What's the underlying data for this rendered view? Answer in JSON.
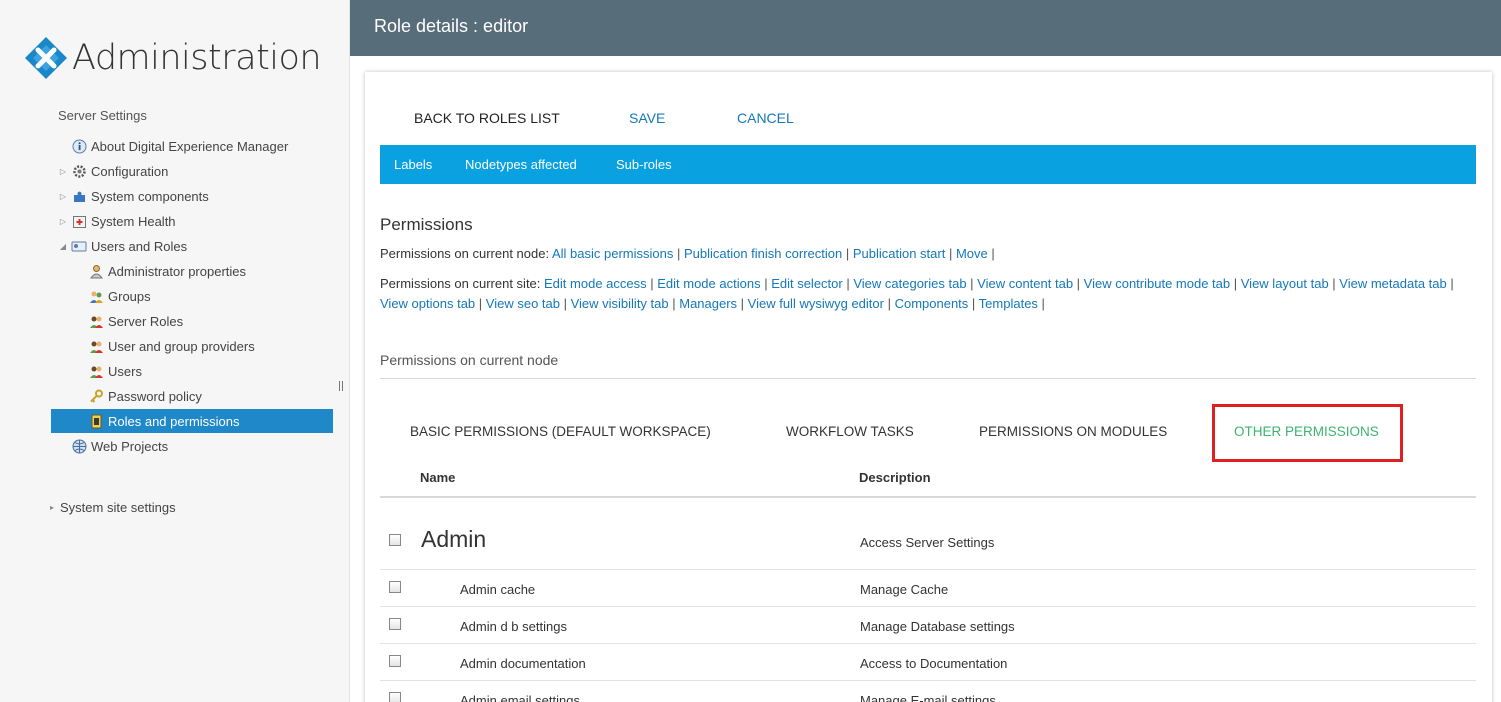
{
  "sidebar": {
    "app_title": "Administration",
    "server_settings_label": "Server Settings",
    "items": [
      {
        "label": "About Digital Experience Manager"
      },
      {
        "label": "Configuration"
      },
      {
        "label": "System components"
      },
      {
        "label": "System Health"
      },
      {
        "label": "Users and Roles"
      },
      {
        "label": "Administrator properties"
      },
      {
        "label": "Groups"
      },
      {
        "label": "Server Roles"
      },
      {
        "label": "User and group providers"
      },
      {
        "label": "Users"
      },
      {
        "label": "Password policy"
      },
      {
        "label": "Roles and permissions"
      },
      {
        "label": "Web Projects"
      }
    ],
    "system_site_settings_label": "System site settings"
  },
  "header": {
    "title": "Role details : editor"
  },
  "actions": {
    "back": "BACK TO ROLES LIST",
    "save": "SAVE",
    "cancel": "CANCEL"
  },
  "tabs": {
    "labels": "Labels",
    "nodetypes": "Nodetypes affected",
    "subroles": "Sub-roles"
  },
  "permissions": {
    "title": "Permissions",
    "node_prefix": "Permissions on current node: ",
    "node_links": [
      "All basic permissions",
      "Publication finish correction",
      "Publication start",
      "Move"
    ],
    "site_prefix": "Permissions on current site: ",
    "site_links": [
      "Edit mode access",
      "Edit mode actions",
      "Edit selector",
      "View categories tab",
      "View content tab",
      "View contribute mode tab",
      "View layout tab",
      "View metadata tab",
      "View options tab",
      "View seo tab",
      "View visibility tab",
      "Managers",
      "View full wysiwyg editor",
      "Components",
      "Templates"
    ]
  },
  "node_section": {
    "title": "Permissions on current node"
  },
  "perm_tabs": {
    "basic": "BASIC PERMISSIONS (DEFAULT WORKSPACE)",
    "workflow": "WORKFLOW TASKS",
    "modules": "PERMISSIONS ON MODULES",
    "other": "OTHER PERMISSIONS"
  },
  "table": {
    "col_name": "Name",
    "col_description": "Description",
    "group": {
      "name": "Admin",
      "description": "Access Server Settings"
    },
    "rows": [
      {
        "name": "Admin cache",
        "description": "Manage Cache"
      },
      {
        "name": "Admin d b settings",
        "description": "Manage Database settings"
      },
      {
        "name": "Admin documentation",
        "description": "Access to Documentation"
      },
      {
        "name": "Admin email settings",
        "description": "Manage E-mail settings"
      }
    ]
  },
  "colors": {
    "accent_blue": "#0aa1e0",
    "header_bg": "#586d7a",
    "selected_bg": "#1e88c9",
    "link": "#1578b8",
    "active_tab": "#3cb371",
    "highlight": "#e02020"
  }
}
